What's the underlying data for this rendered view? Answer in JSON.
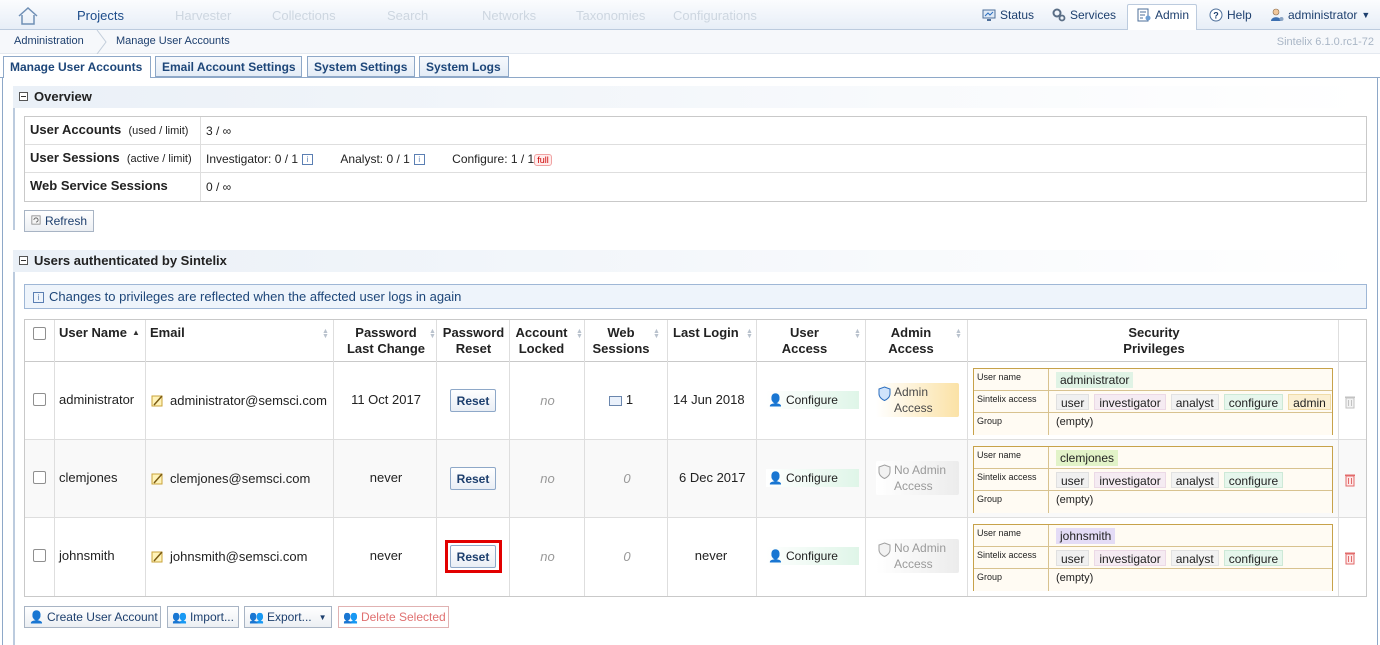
{
  "topnav": {
    "projects": "Projects",
    "harvester": "Harvester",
    "collections": "Collections",
    "search": "Search",
    "networks": "Networks",
    "taxonomies": "Taxonomies",
    "configurations": "Configurations",
    "status": "Status",
    "services": "Services",
    "admin": "Admin",
    "help": "Help",
    "user": "administrator"
  },
  "breadcrumb": {
    "root": "Administration",
    "current": "Manage User Accounts",
    "version": "Sintelix 6.1.0.rc1-72"
  },
  "tabs": [
    "Manage User Accounts",
    "Email Account Settings",
    "System Settings",
    "System Logs"
  ],
  "overview": {
    "title": "Overview",
    "accounts_label": "User Accounts",
    "accounts_hint": "(used / limit)",
    "accounts_value": "3 / ∞",
    "sessions_label": "User Sessions",
    "sessions_hint": "(active / limit)",
    "inv_label": "Investigator:",
    "inv_value": "0 / 1",
    "ana_label": "Analyst:",
    "ana_value": "0 / 1",
    "cfg_label": "Configure:",
    "cfg_value": "1 / 1",
    "full_badge": "full",
    "ws_label": "Web Service Sessions",
    "ws_value": "0 / ∞",
    "refresh": "Refresh"
  },
  "users_section": {
    "title": "Users authenticated by Sintelix",
    "note": "Changes to privileges are reflected when the affected user logs in again"
  },
  "columns": {
    "username": "User Name",
    "email": "Email",
    "pw_change": [
      "Password",
      "Last Change"
    ],
    "pw_reset": [
      "Password",
      "Reset"
    ],
    "locked": [
      "Account",
      "Locked"
    ],
    "web": [
      "Web",
      "Sessions"
    ],
    "last_login": "Last Login",
    "user_access": [
      "User",
      "Access"
    ],
    "admin_access": [
      "Admin",
      "Access"
    ],
    "security": [
      "Security",
      "Privileges"
    ]
  },
  "priv_labels": {
    "username": "User name",
    "access": "Sintelix access",
    "group": "Group"
  },
  "users": [
    {
      "username": "administrator",
      "email": "administrator@semsci.com",
      "pw_change": "11 Oct 2017",
      "reset": "Reset",
      "locked": "no",
      "web": "1",
      "last_login": "14 Jun 2018",
      "user_access": "Configure",
      "admin": [
        "Admin",
        "Access"
      ],
      "priv_name": "administrator",
      "access_tags": [
        "user",
        "investigator",
        "analyst",
        "configure",
        "admin"
      ],
      "group": "(empty)"
    },
    {
      "username": "clemjones",
      "email": "clemjones@semsci.com",
      "pw_change": "never",
      "reset": "Reset",
      "locked": "no",
      "web": "0",
      "last_login": "6 Dec 2017",
      "user_access": "Configure",
      "admin": [
        "No Admin",
        "Access"
      ],
      "priv_name": "clemjones",
      "access_tags": [
        "user",
        "investigator",
        "analyst",
        "configure"
      ],
      "group": "(empty)"
    },
    {
      "username": "johnsmith",
      "email": "johnsmith@semsci.com",
      "pw_change": "never",
      "reset": "Reset",
      "locked": "no",
      "web": "0",
      "last_login": "never",
      "user_access": "Configure",
      "admin": [
        "No Admin",
        "Access"
      ],
      "priv_name": "johnsmith",
      "access_tags": [
        "user",
        "investigator",
        "analyst",
        "configure"
      ],
      "group": "(empty)"
    }
  ],
  "bottom": {
    "create": "Create User Account",
    "import": "Import...",
    "export": "Export...",
    "delete": "Delete Selected"
  }
}
